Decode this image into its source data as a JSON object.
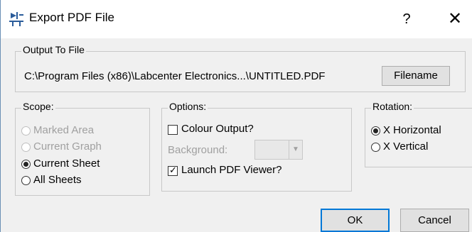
{
  "window": {
    "title": "Export PDF File",
    "help_glyph": "?",
    "close_glyph": "✕"
  },
  "output_group": {
    "legend": "Output To File",
    "path": "C:\\Program Files (x86)\\Labcenter Electronics...\\UNTITLED.PDF",
    "filename_button": "Filename"
  },
  "scope_group": {
    "legend": "Scope:",
    "options": [
      {
        "label": "Marked Area",
        "checked": false,
        "enabled": false
      },
      {
        "label": "Current Graph",
        "checked": false,
        "enabled": false
      },
      {
        "label": "Current Sheet",
        "checked": true,
        "enabled": true
      },
      {
        "label": "All Sheets",
        "checked": false,
        "enabled": true
      }
    ]
  },
  "options_group": {
    "legend": "Options:",
    "colour_output": {
      "label": "Colour Output?",
      "checked": false
    },
    "background_label": "Background:",
    "launch_viewer": {
      "label": "Launch PDF Viewer?",
      "checked": true
    }
  },
  "rotation_group": {
    "legend": "Rotation:",
    "options": [
      {
        "label": "X Horizontal",
        "checked": true
      },
      {
        "label": "X Vertical",
        "checked": false
      }
    ]
  },
  "footer": {
    "ok_label": "OK",
    "cancel_label": "Cancel"
  },
  "icons": {
    "app_icon": "export-pdf-icon",
    "combo_arrow": "chevron-down-icon"
  }
}
